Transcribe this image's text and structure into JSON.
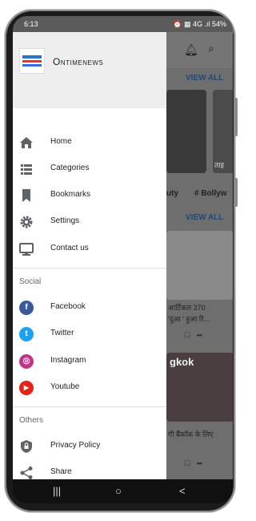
{
  "status_bar": {
    "time": "6:13",
    "icons_right": "⏰ ▦ 4G .ıl 54%"
  },
  "drawer": {
    "app_name": "Ontimenews",
    "logo_icon": "ontimenews-logo",
    "items": [
      {
        "label": "Home",
        "icon": "home-icon"
      },
      {
        "label": "Categories",
        "icon": "list-icon"
      },
      {
        "label": "Bookmarks",
        "icon": "bookmark-icon"
      },
      {
        "label": "Settings",
        "icon": "gear-icon"
      },
      {
        "label": "Contact us",
        "icon": "monitor-icon"
      }
    ],
    "social_header": "Social",
    "social": [
      {
        "label": "Facebook",
        "glyph": "f",
        "color": "#3b5998"
      },
      {
        "label": "Twitter",
        "glyph": "t",
        "color": "#1da1f2"
      },
      {
        "label": "Instagram",
        "glyph": "◎",
        "color": "#c13584"
      },
      {
        "label": "Youtube",
        "glyph": "▶",
        "color": "#e62117"
      }
    ],
    "others_header": "Others",
    "others": [
      {
        "label": "Privacy Policy",
        "icon": "shield-lock-icon"
      },
      {
        "label": "Share",
        "icon": "share-icon"
      }
    ]
  },
  "background": {
    "view_all_1": "VIEW ALL",
    "view_all_2": "VIEW ALL",
    "tags": [
      "uty",
      "# Bollyw"
    ],
    "thumb_text_1": "ताइ",
    "headline_1_line1": "आर्टिकल 370",
    "headline_1_line2": "'दुआ ' हुआ रि...",
    "image_text_2": "gkok",
    "headline_2": "गी बैंकॉक के लिए"
  },
  "nav": {
    "recents": "|||",
    "home": "○",
    "back": "<"
  },
  "colors": {
    "accent": "#20477a",
    "drawer_bg": "#ffffff",
    "header_bg": "#eeeeee"
  }
}
